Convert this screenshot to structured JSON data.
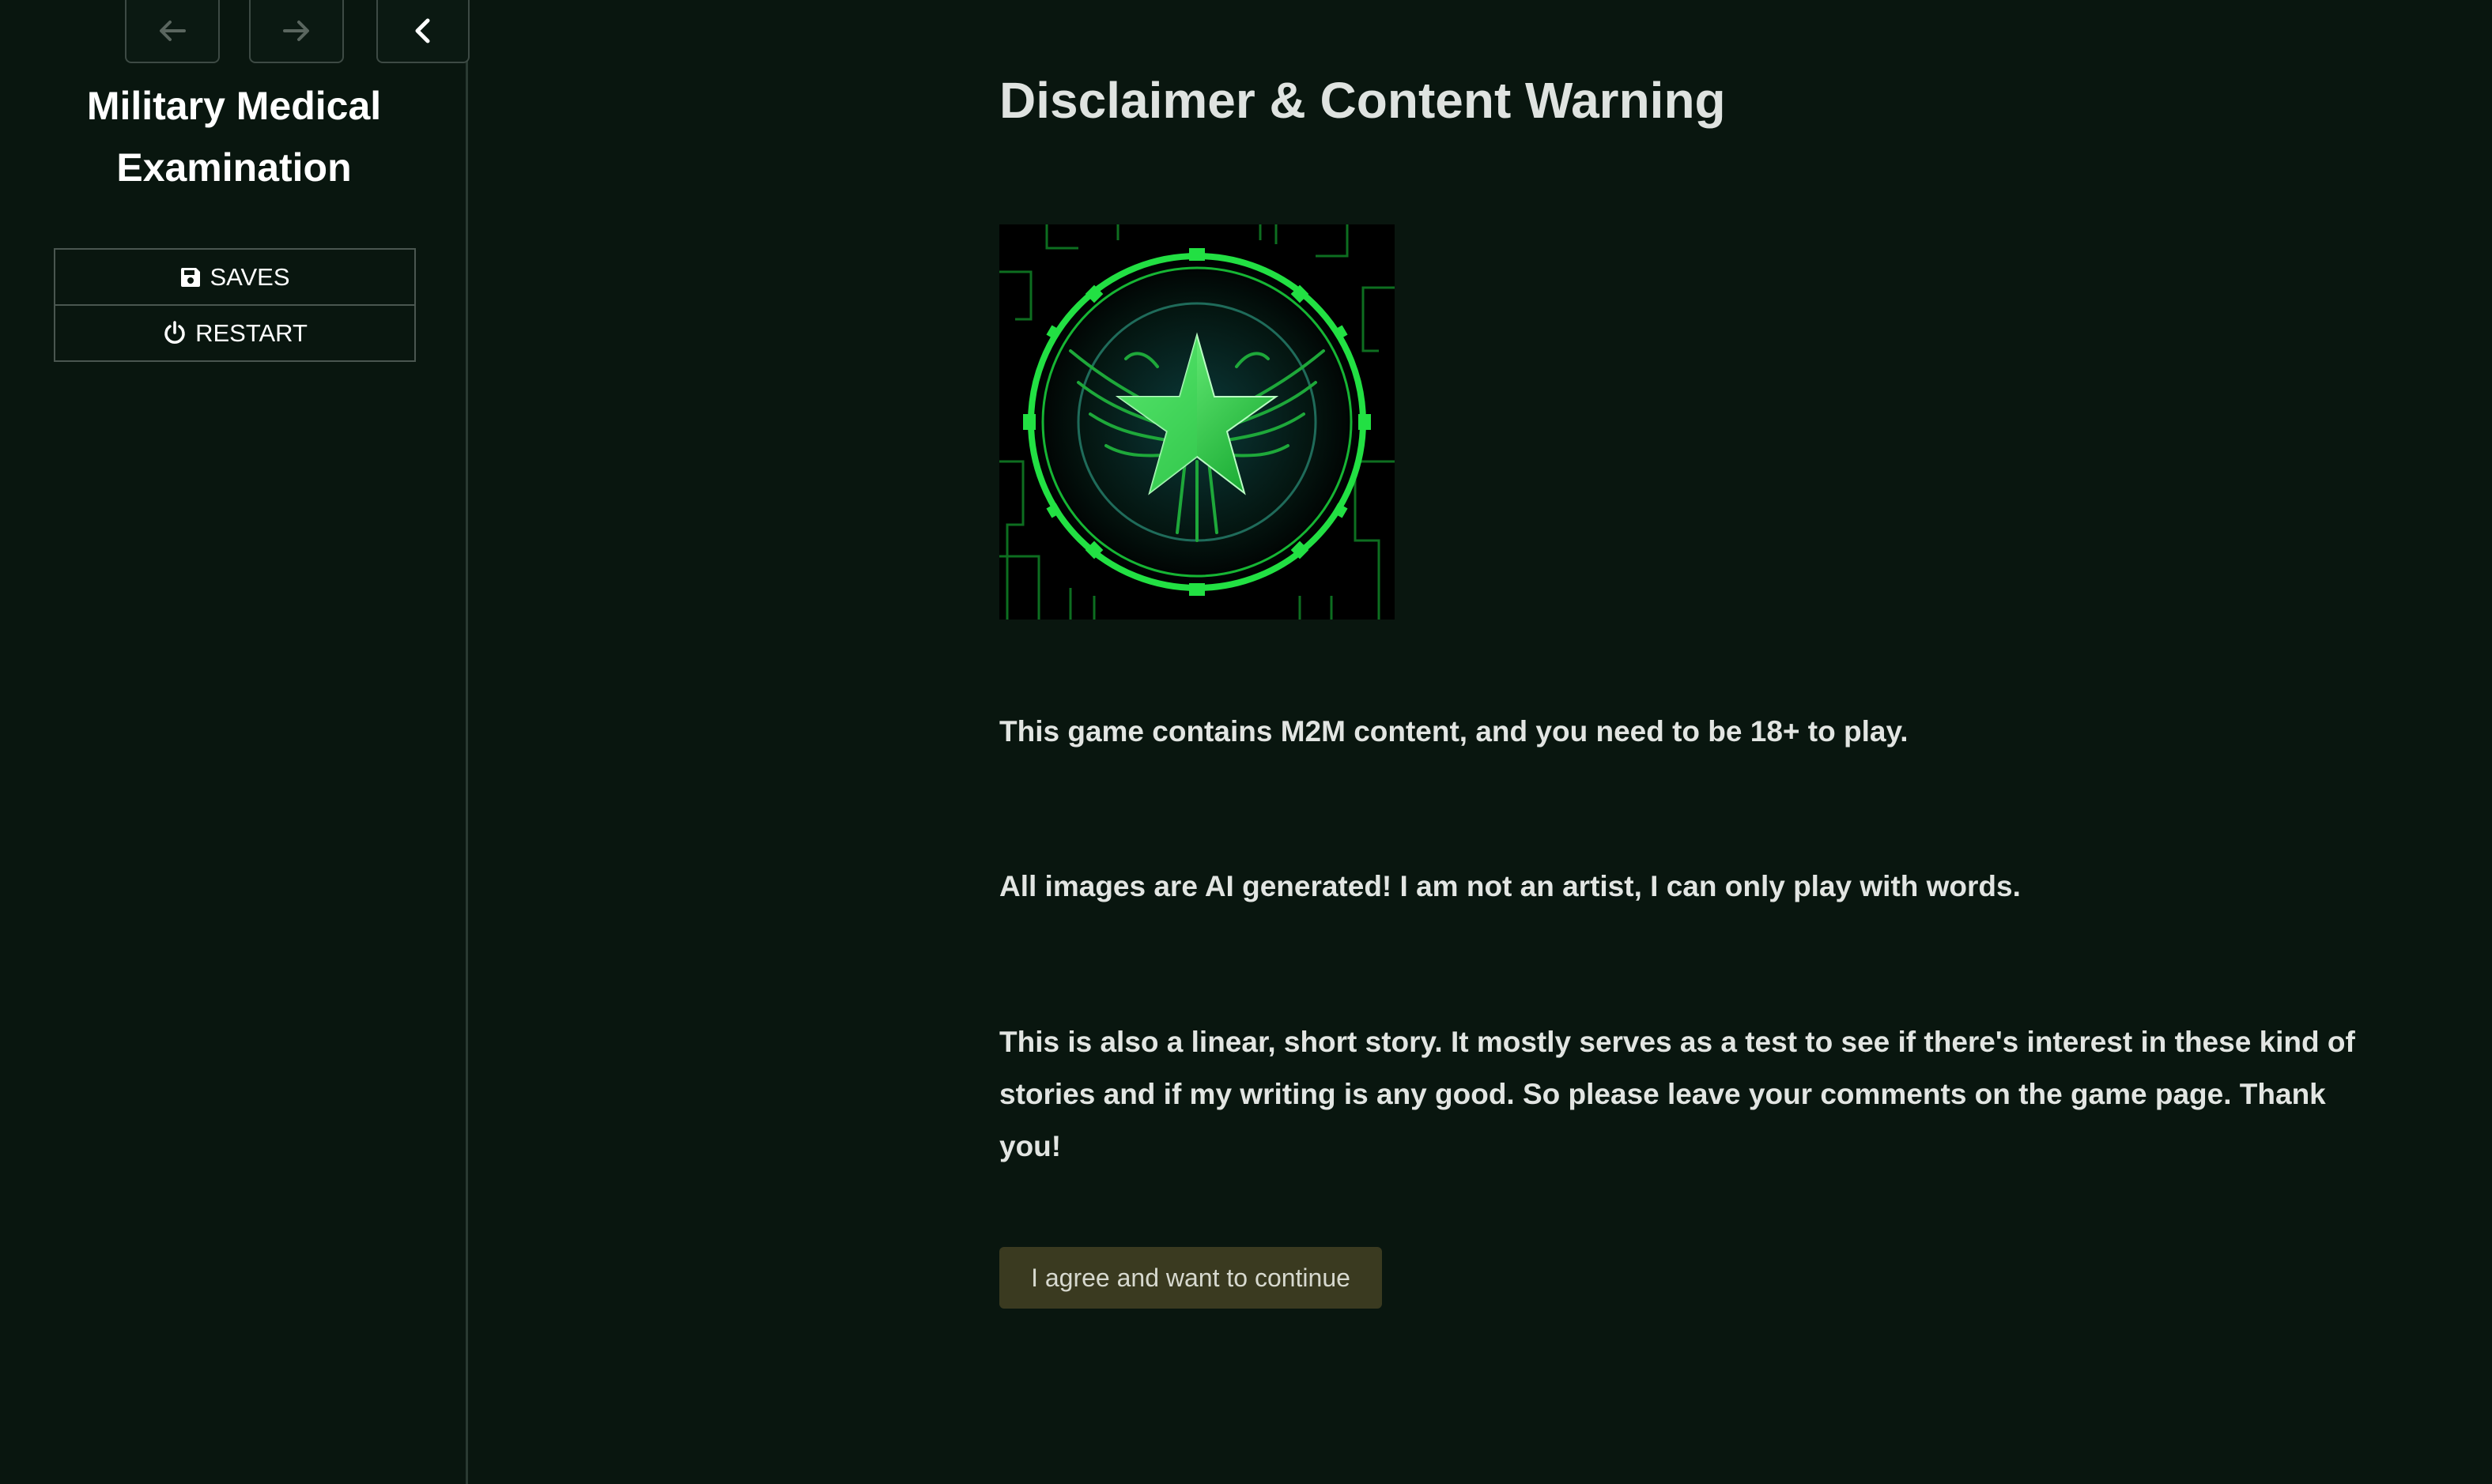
{
  "ui_bar": {
    "history": {
      "back_icon": "arrow-left-icon",
      "forward_icon": "arrow-right-icon",
      "toggle_icon": "chevron-left-icon"
    },
    "story_title_line1": "Military Medical",
    "story_title_line2": "Examination",
    "menu": [
      {
        "label": "SAVES",
        "icon": "floppy-disk-icon"
      },
      {
        "label": "RESTART",
        "icon": "power-icon"
      }
    ]
  },
  "passage": {
    "title": "Disclaimer & Content Warning",
    "image_icon": "eagle-star-emblem",
    "paragraphs": [
      "This game contains M2M content, and you need to be 18+ to play.",
      "All images are AI generated! I am not an artist, I can only play with words.",
      "This is also a linear, short story. It mostly serves as a test to see if there's interest in these kind of stories and if my writing is any good. So please leave your comments on the game page. Thank you!"
    ],
    "continue_label": "I agree and want to continue"
  },
  "colors": {
    "background": "#09160f",
    "emblem_green": "#22e043",
    "button_bg": "#3a3a20"
  }
}
